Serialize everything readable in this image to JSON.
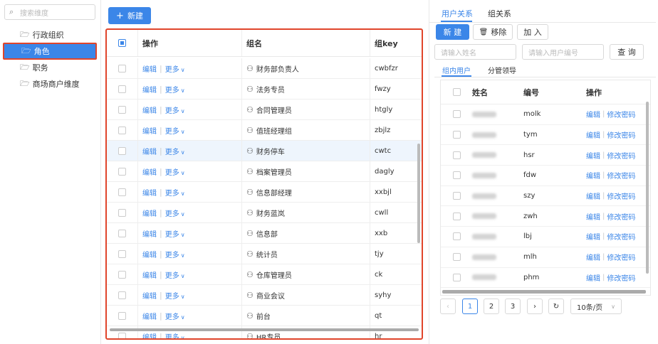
{
  "sidebar": {
    "search_placeholder": "搜索维度",
    "items": [
      {
        "label": "行政组织"
      },
      {
        "label": "角色"
      },
      {
        "label": "职务"
      },
      {
        "label": "商场商户维度"
      }
    ]
  },
  "middle": {
    "new_button": "新建",
    "columns": {
      "op": "操作",
      "name": "组名",
      "key": "组key"
    },
    "edit_label": "编辑",
    "more_label": "更多",
    "rows": [
      {
        "name": "财务部负责人",
        "key": "cwbfzr"
      },
      {
        "name": "法务专员",
        "key": "fwzy"
      },
      {
        "name": "合同管理员",
        "key": "htgly"
      },
      {
        "name": "值班经理组",
        "key": "zbjlz"
      },
      {
        "name": "财务停车",
        "key": "cwtc"
      },
      {
        "name": "档案管理员",
        "key": "dagly"
      },
      {
        "name": "信息部经理",
        "key": "xxbjl"
      },
      {
        "name": "财务蓝岚",
        "key": "cwll"
      },
      {
        "name": "信息部",
        "key": "xxb"
      },
      {
        "name": "统计员",
        "key": "tjy"
      },
      {
        "name": "仓库管理员",
        "key": "ck"
      },
      {
        "name": "商业会议",
        "key": "syhy"
      },
      {
        "name": "前台",
        "key": "qt"
      },
      {
        "name": "HR专员",
        "key": "hr"
      }
    ]
  },
  "right": {
    "tabs": [
      "用户关系",
      "组关系"
    ],
    "buttons": {
      "new": "新 建",
      "remove": "移除",
      "add": "加 入",
      "query": "查 询"
    },
    "name_placeholder": "请输入姓名",
    "userno_placeholder": "请输入用户编号",
    "subtabs": [
      "组内用户",
      "分管领导"
    ],
    "columns": {
      "name": "姓名",
      "no": "编号",
      "op": "操作"
    },
    "edit_label": "编辑",
    "changepwd_label": "修改密码",
    "rows": [
      {
        "no": "molk"
      },
      {
        "no": "tym"
      },
      {
        "no": "hsr"
      },
      {
        "no": "fdw"
      },
      {
        "no": "szy"
      },
      {
        "no": "zwh"
      },
      {
        "no": "lbj"
      },
      {
        "no": "mlh"
      },
      {
        "no": "phm"
      }
    ],
    "pagination": {
      "pages": [
        "1",
        "2",
        "3"
      ],
      "page_size": "10条/页"
    }
  }
}
